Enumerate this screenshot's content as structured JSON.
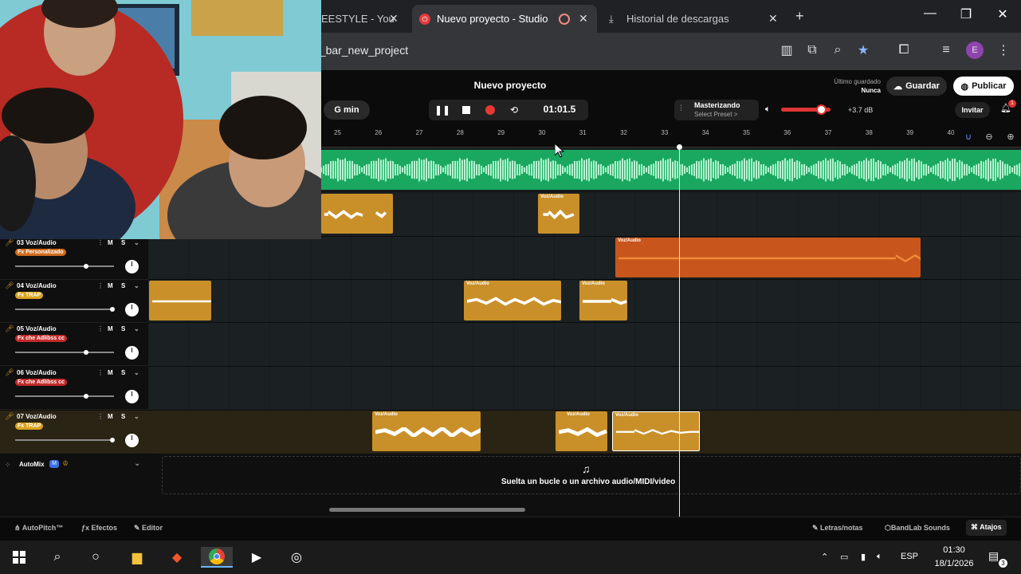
{
  "browser": {
    "tabs": [
      {
        "label": "EESTYLE - You",
        "active": false
      },
      {
        "label": "Nuevo proyecto - Studio",
        "active": true
      },
      {
        "label": "Historial de descargas",
        "active": false
      }
    ],
    "address": "p_bar_new_project",
    "profile_initial": "E"
  },
  "studio": {
    "project_title": "Nuevo proyecto",
    "key": "G min",
    "time": "01:01.5",
    "mastering_label": "Masterizando",
    "mastering_preset": "Select Preset >",
    "volume_db": "+3.7 dB",
    "volume_level": 0.7,
    "last_saved_label": "Último guardado",
    "last_saved_value": "Nunca",
    "save_label": "Guardar",
    "publish_label": "Publicar",
    "invite_label": "Invitar",
    "notification_count": "1"
  },
  "ruler": {
    "bars": [
      "25",
      "26",
      "27",
      "28",
      "29",
      "30",
      "31",
      "32",
      "33",
      "34",
      "35",
      "36",
      "37",
      "38",
      "39",
      "40"
    ]
  },
  "tracks": [
    {
      "name": "03 Voz/Audio",
      "fx": "Fx Personalizado",
      "fx_color": "orange",
      "mute": "M",
      "solo": "S",
      "volume": 0.72
    },
    {
      "name": "04 Voz/Audio",
      "fx": "Fx TRAP",
      "fx_color": "yellow",
      "mute": "M",
      "solo": "S",
      "volume": 0.98
    },
    {
      "name": "05 Voz/Audio",
      "fx": "Fx che Adlibss cc",
      "fx_color": "red",
      "mute": "M",
      "solo": "S",
      "volume": 0.72
    },
    {
      "name": "06 Voz/Audio",
      "fx": "Fx che Adlibss cc",
      "fx_color": "red",
      "mute": "M",
      "solo": "S",
      "volume": 0.72
    },
    {
      "name": "07 Voz/Audio",
      "fx": "Fx TRAP",
      "fx_color": "yellow",
      "mute": "M",
      "solo": "S",
      "volume": 0.98
    }
  ],
  "clip_label": "Voz/Audio",
  "automix_label": "AutoMix",
  "drop_text": "Suelta un bucle o un archivo audio/MIDI/video",
  "bottom_bar": {
    "autopitch": "AutoPitch™",
    "effects": "Efectos",
    "editor": "Editor",
    "lyrics": "Letras/notas",
    "sounds": "BandLab Sounds",
    "shortcuts": "Atajos"
  },
  "taskbar": {
    "language": "ESP",
    "time": "01:30",
    "date": "18/1/2026",
    "notif_count": "3"
  }
}
